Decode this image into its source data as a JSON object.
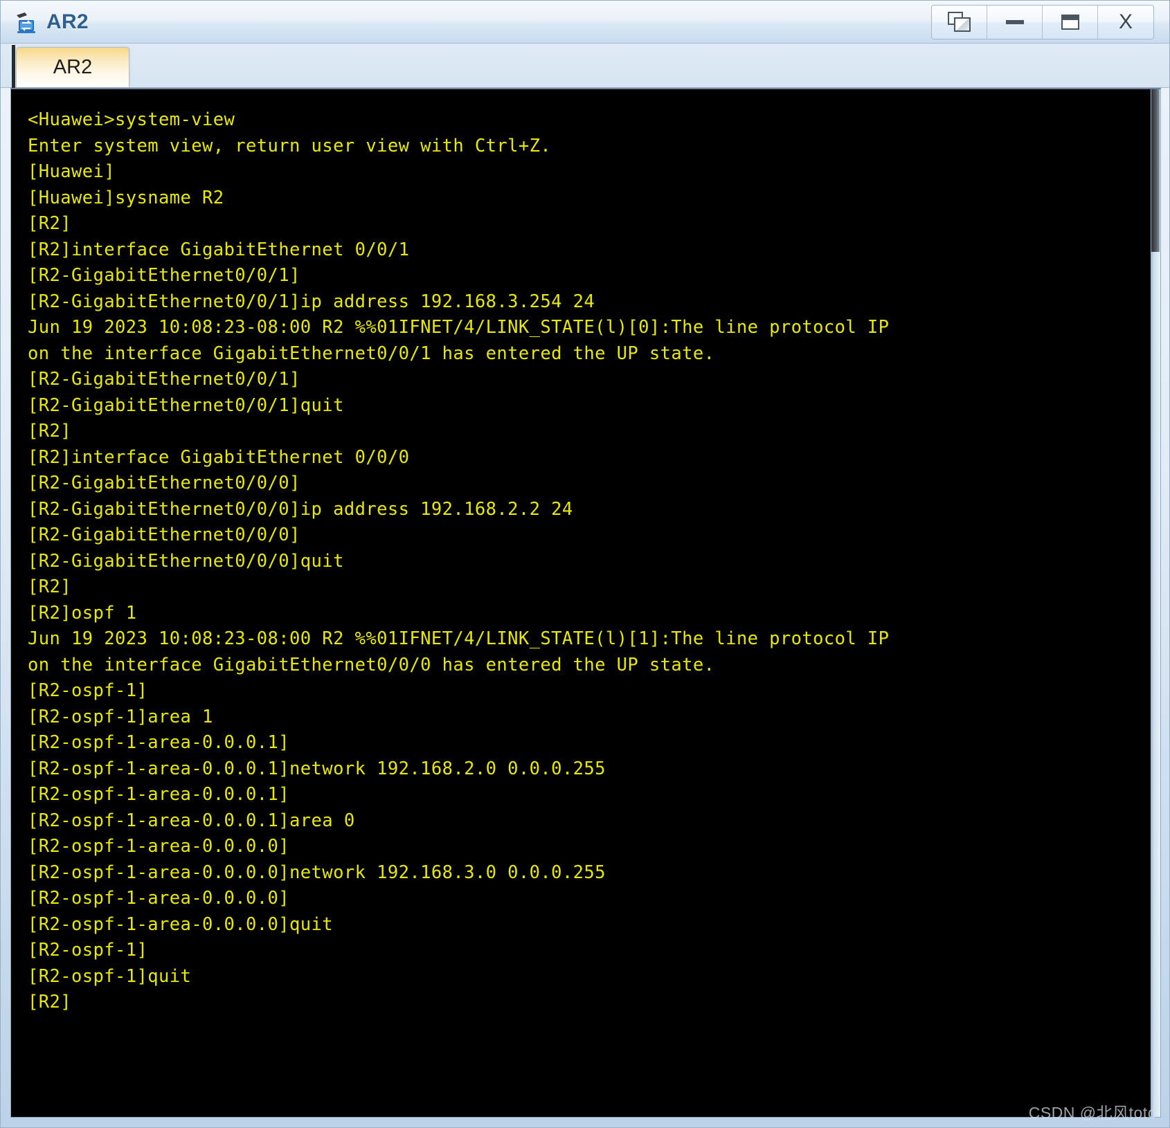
{
  "window": {
    "title": "AR2",
    "icon": "router-icon",
    "controls": [
      {
        "name": "restore-window-button",
        "icon": "restore-icon",
        "label": ""
      },
      {
        "name": "minimize-button",
        "icon": "minimize-icon",
        "label": ""
      },
      {
        "name": "maximize-button",
        "icon": "maximize-icon",
        "label": ""
      },
      {
        "name": "close-button",
        "icon": "close-icon",
        "label": "X"
      }
    ]
  },
  "tabs": [
    {
      "label": "AR2",
      "active": true
    }
  ],
  "terminal": {
    "foreground_color": "#e8e800",
    "background_color": "#000000",
    "lines": [
      "<Huawei>system-view",
      "Enter system view, return user view with Ctrl+Z.",
      "[Huawei]",
      "[Huawei]sysname R2",
      "[R2]",
      "[R2]interface GigabitEthernet 0/0/1",
      "[R2-GigabitEthernet0/0/1]",
      "[R2-GigabitEthernet0/0/1]ip address 192.168.3.254 24",
      "Jun 19 2023 10:08:23-08:00 R2 %%01IFNET/4/LINK_STATE(l)[0]:The line protocol IP",
      "on the interface GigabitEthernet0/0/1 has entered the UP state.",
      "[R2-GigabitEthernet0/0/1]",
      "[R2-GigabitEthernet0/0/1]quit",
      "[R2]",
      "[R2]interface GigabitEthernet 0/0/0",
      "[R2-GigabitEthernet0/0/0]",
      "[R2-GigabitEthernet0/0/0]ip address 192.168.2.2 24",
      "[R2-GigabitEthernet0/0/0]",
      "[R2-GigabitEthernet0/0/0]quit",
      "[R2]",
      "[R2]ospf 1",
      "Jun 19 2023 10:08:23-08:00 R2 %%01IFNET/4/LINK_STATE(l)[1]:The line protocol IP",
      "on the interface GigabitEthernet0/0/0 has entered the UP state.",
      "[R2-ospf-1]",
      "[R2-ospf-1]area 1",
      "[R2-ospf-1-area-0.0.0.1]",
      "[R2-ospf-1-area-0.0.0.1]network 192.168.2.0 0.0.0.255",
      "[R2-ospf-1-area-0.0.0.1]",
      "[R2-ospf-1-area-0.0.0.1]area 0",
      "[R2-ospf-1-area-0.0.0.0]",
      "[R2-ospf-1-area-0.0.0.0]network 192.168.3.0 0.0.0.255",
      "[R2-ospf-1-area-0.0.0.0]",
      "[R2-ospf-1-area-0.0.0.0]quit",
      "[R2-ospf-1]",
      "[R2-ospf-1]quit",
      "[R2]"
    ]
  },
  "watermark": {
    "text": "CSDN @北风toto"
  }
}
